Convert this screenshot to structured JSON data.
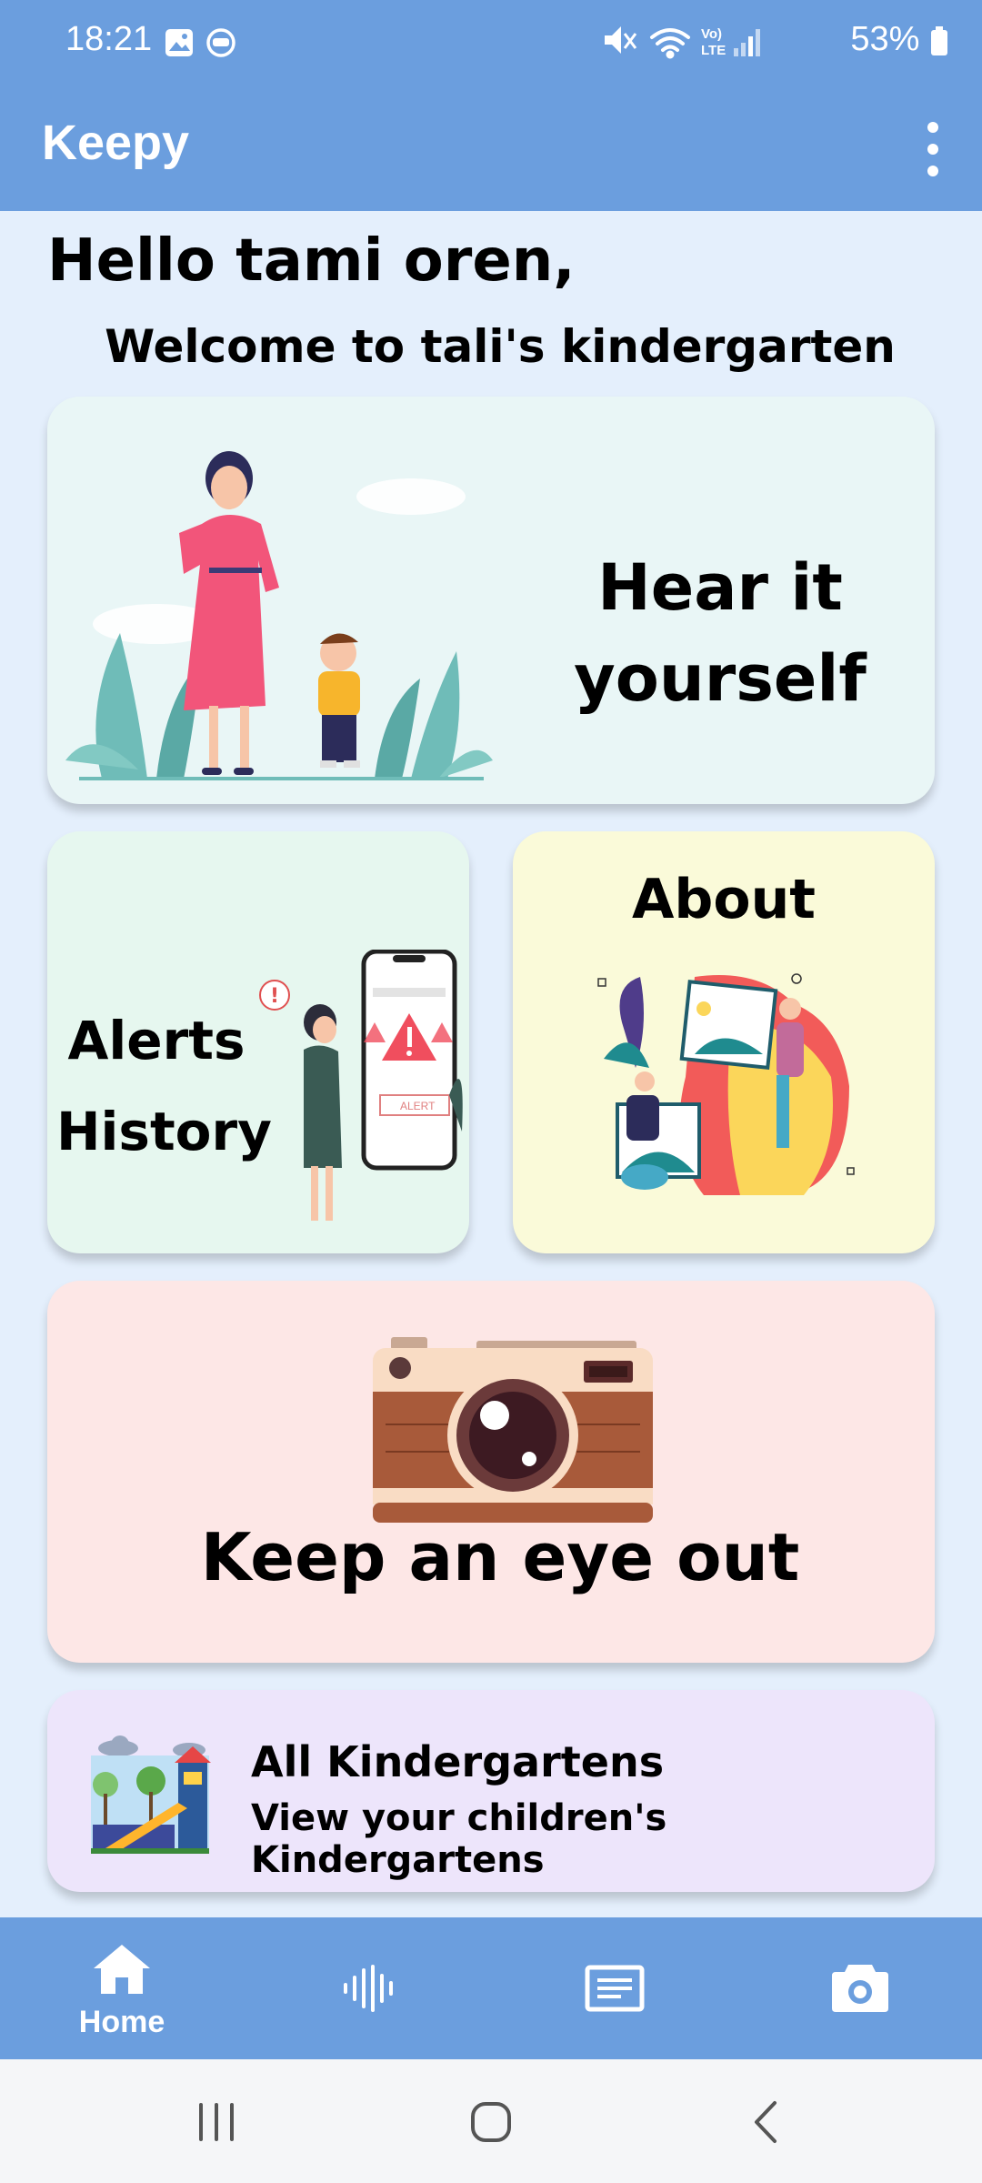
{
  "status_bar": {
    "time": "18:21",
    "battery": "53%",
    "icons_left": [
      "image-icon",
      "app-face-icon"
    ],
    "icons_right": [
      "mute-icon",
      "wifi-icon",
      "volte-icon",
      "signal-icon",
      "battery-icon"
    ]
  },
  "app_bar": {
    "title": "Keepy",
    "menu_icon": "more-vert-icon"
  },
  "greeting": {
    "hello": "Hello tami oren,",
    "welcome": "Welcome to tali's kindergarten"
  },
  "cards": {
    "hear": {
      "line1": "Hear it",
      "line2": "yourself"
    },
    "alerts": {
      "line1": "Alerts",
      "line2": "History",
      "alert_button": "ALERT"
    },
    "about": {
      "title": "About"
    },
    "keep": {
      "title": "Keep an eye out"
    },
    "kindergartens": {
      "title": "All Kindergartens",
      "subtitle": "View your children's Kindergartens"
    }
  },
  "bottom_nav": {
    "items": [
      {
        "icon": "home-icon",
        "label": "Home"
      },
      {
        "icon": "audio-waveform-icon",
        "label": ""
      },
      {
        "icon": "list-icon",
        "label": ""
      },
      {
        "icon": "camera-icon",
        "label": ""
      }
    ]
  },
  "colors": {
    "primary": "#6b9ede",
    "background": "#e4effc",
    "card_hear": "#e9f6f6",
    "card_alerts": "#e6f7ef",
    "card_about": "#fafad9",
    "card_keep": "#fde7e6",
    "card_kinder": "#ede5fb"
  }
}
